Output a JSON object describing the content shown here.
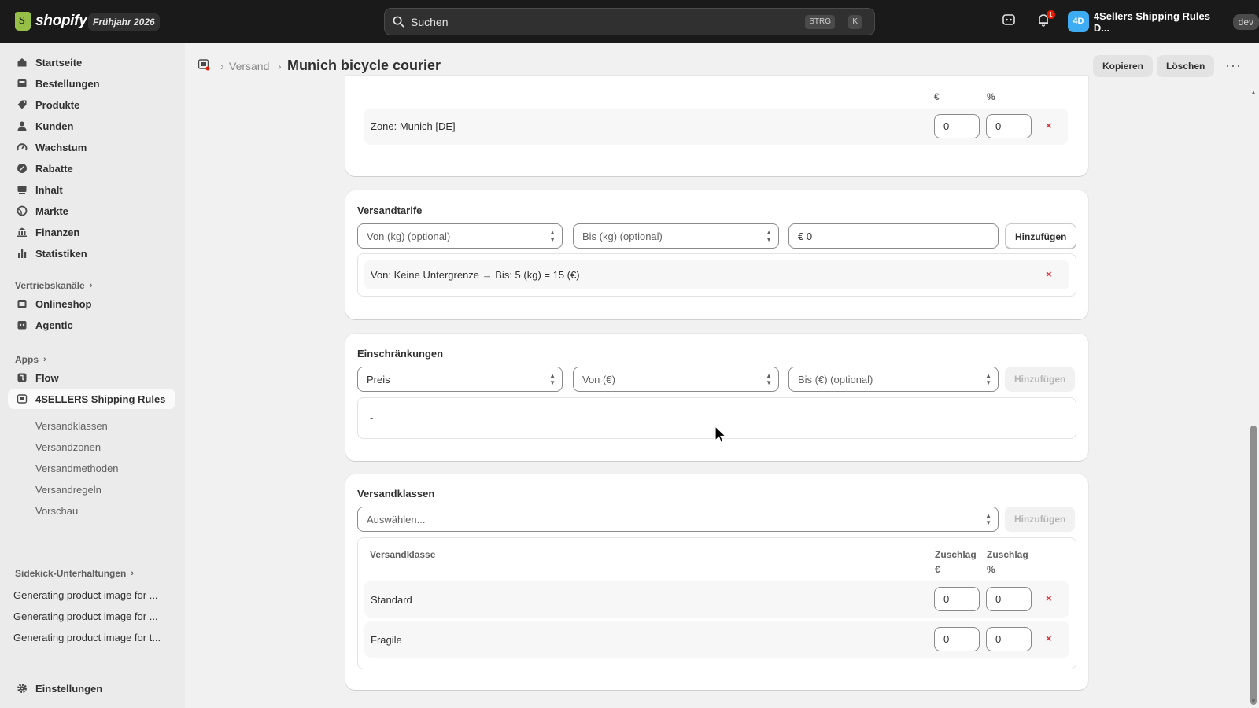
{
  "topbar": {
    "logo_text": "shopify",
    "edition": "Frühjahr 2026",
    "search_placeholder": "Suchen",
    "shortcut_1": "STRG",
    "shortcut_2": "K",
    "notification_count": "1",
    "store_initials": "4D",
    "store_name": "4Sellers Shipping Rules D...",
    "store_tag": "dev"
  },
  "sidebar": {
    "items": [
      {
        "label": "Startseite",
        "icon": "home-icon"
      },
      {
        "label": "Bestellungen",
        "icon": "inbox-icon"
      },
      {
        "label": "Produkte",
        "icon": "tag-icon"
      },
      {
        "label": "Kunden",
        "icon": "person-icon"
      },
      {
        "label": "Wachstum",
        "icon": "gauge-icon"
      },
      {
        "label": "Rabatte",
        "icon": "discount-icon"
      },
      {
        "label": "Inhalt",
        "icon": "content-icon"
      },
      {
        "label": "Märkte",
        "icon": "globe-icon"
      },
      {
        "label": "Finanzen",
        "icon": "bank-icon"
      },
      {
        "label": "Statistiken",
        "icon": "chart-icon"
      }
    ],
    "sales_channels_label": "Vertriebskanäle",
    "channels": [
      {
        "label": "Onlineshop",
        "icon": "store-icon"
      },
      {
        "label": "Agentic",
        "icon": "agent-icon"
      }
    ],
    "apps_label": "Apps",
    "apps": [
      {
        "label": "Flow",
        "icon": "flow-icon"
      },
      {
        "label": "4SELLERS Shipping Rules",
        "icon": "app-icon"
      }
    ],
    "app_subitems": [
      "Versandklassen",
      "Versandzonen",
      "Versandmethoden",
      "Versandregeln",
      "Vorschau"
    ],
    "sidekick_label": "Sidekick-Unterhaltungen",
    "conversations": [
      "Generating product image for ...",
      "Generating product image for ...",
      "Generating product image for t..."
    ],
    "settings_label": "Einstellungen"
  },
  "header": {
    "breadcrumb": "Versand",
    "title": "Munich bicycle courier",
    "copy_label": "Kopieren",
    "delete_label": "Löschen"
  },
  "zones_card": {
    "col_eur_unit": "€",
    "col_pct_unit": "%",
    "row_label": "Zone: Munich [DE]",
    "surcharge_eur": "0",
    "surcharge_pct": "0"
  },
  "rates_card": {
    "title": "Versandtarife",
    "from_placeholder": "Von (kg) (optional)",
    "to_placeholder": "Bis (kg) (optional)",
    "price_value": "€ 0",
    "add_label": "Hinzufügen",
    "rate_row": "Von: Keine Untergrenze → Bis: 5 (kg) = 15 (€)"
  },
  "restrictions_card": {
    "title": "Einschränkungen",
    "type_value": "Preis",
    "from_placeholder": "Von (€)",
    "to_placeholder": "Bis (€) (optional)",
    "add_label": "Hinzufügen",
    "empty_text": "-"
  },
  "classes_card": {
    "title": "Versandklassen",
    "select_placeholder": "Auswählen...",
    "add_label": "Hinzufügen",
    "col_class": "Versandklasse",
    "col_eur": "Zuschlag",
    "col_eur_unit": "€",
    "col_pct": "Zuschlag",
    "col_pct_unit": "%",
    "rows": [
      {
        "label": "Standard",
        "eur": "0",
        "pct": "0"
      },
      {
        "label": "Fragile",
        "eur": "0",
        "pct": "0"
      }
    ]
  },
  "colors": {
    "topbar_bg": "#1a1a1a",
    "delete_x": "#e22c38",
    "avatar": "#3dacf2"
  }
}
